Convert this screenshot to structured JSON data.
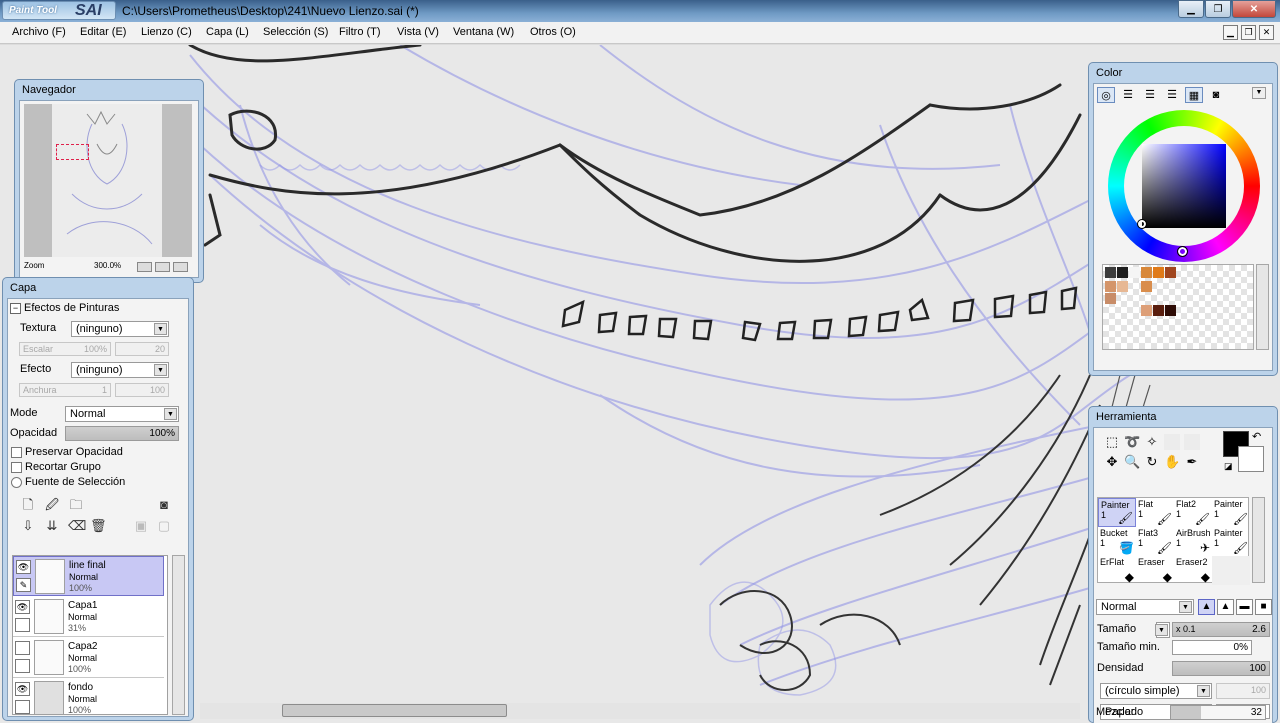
{
  "window": {
    "logo_small": "Paint Tool",
    "logo_big": "SAI",
    "title": "C:\\Users\\Prometheus\\Desktop\\241\\Nuevo Lienzo.sai (*)"
  },
  "menu": [
    "Archivo (F)",
    "Editar (E)",
    "Lienzo (C)",
    "Capa (L)",
    "Selección (S)",
    "Filtro (T)",
    "Vista (V)",
    "Ventana (W)",
    "Otros (O)"
  ],
  "navigator": {
    "title": "Navegador",
    "zoom_label": "Zoom",
    "zoom_value": "300.0%"
  },
  "layer_panel": {
    "title": "Capa",
    "effects_header": "Efectos de Pinturas",
    "texture_label": "Textura",
    "texture_value": "(ninguno)",
    "scale_label": "Escalar",
    "scale_percent": "100%",
    "scale_value": "20",
    "effect_label": "Efecto",
    "effect_value": "(ninguno)",
    "width_label": "Anchura",
    "width_value_1": "1",
    "width_value_2": "100",
    "mode_label": "Mode",
    "mode_value": "Normal",
    "opacity_label": "Opacidad",
    "opacity_value": "100%",
    "preserve_opacity": "Preservar Opacidad",
    "clip_group": "Recortar Grupo",
    "selection_source": "Fuente de Selección",
    "layers": [
      {
        "name": "line final",
        "mode": "Normal",
        "opacity": "100%",
        "visible": true,
        "selected": true
      },
      {
        "name": "Capa1",
        "mode": "Normal",
        "opacity": "31%",
        "visible": true,
        "selected": false
      },
      {
        "name": "Capa2",
        "mode": "Normal",
        "opacity": "100%",
        "visible": false,
        "selected": false
      },
      {
        "name": "fondo",
        "mode": "Normal",
        "opacity": "100%",
        "visible": true,
        "selected": false
      }
    ]
  },
  "color_panel": {
    "title": "Color",
    "swatches": [
      "#3c3c3c",
      "#1e1e1e",
      "#f5f5f5",
      "#d8883a",
      "#e07a18",
      "#a0461e",
      "#d4956a",
      "#e7b894",
      "#d98d4c",
      "#c88c68",
      "#dd9f78",
      "#5a1e0e",
      "#2e0c06"
    ]
  },
  "tool_panel": {
    "title": "Herramienta",
    "brushes": [
      {
        "name": "Painter",
        "size": "1"
      },
      {
        "name": "Flat",
        "size": "1"
      },
      {
        "name": "Flat2",
        "size": "1"
      },
      {
        "name": "Painter",
        "size": "1"
      },
      {
        "name": "Bucket",
        "size": "1"
      },
      {
        "name": "Flat3",
        "size": "1"
      },
      {
        "name": "AirBrush",
        "size": "1"
      },
      {
        "name": "Painter",
        "size": "1"
      },
      {
        "name": "ErFlat",
        "size": ""
      },
      {
        "name": "Eraser",
        "size": ""
      },
      {
        "name": "Eraser2",
        "size": ""
      },
      {
        "name": "",
        "size": ""
      }
    ],
    "blend_mode": "Normal",
    "size_label": "Tamaño",
    "size_multiplier": "x 0.1",
    "size_value": "2.6",
    "min_size_label": "Tamaño min.",
    "min_size_value": "0%",
    "density_label": "Densidad",
    "density_value": "100",
    "shape_value": "(círculo simple)",
    "shape_strength": "100",
    "texture_value": "Paper",
    "texture_strength": "0",
    "blend_label": "Mezclado",
    "blend_value": "32"
  }
}
